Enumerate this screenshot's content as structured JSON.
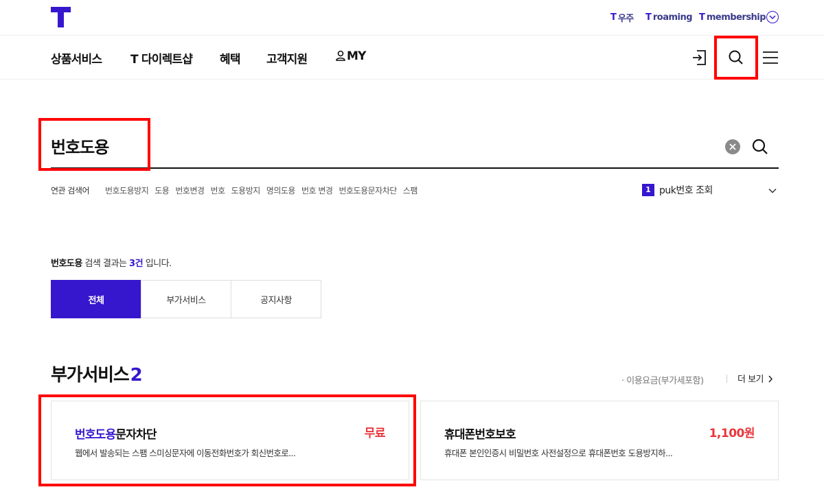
{
  "colors": {
    "brand": "#3617ce",
    "price": "#e8363b",
    "highlight": "#ff0000"
  },
  "utility_links": [
    {
      "mark": "T",
      "label": "우주"
    },
    {
      "mark": "T",
      "label": "roaming"
    },
    {
      "mark": "T",
      "label": "membership"
    }
  ],
  "gnb": {
    "items": [
      "상품서비스",
      "T 다이렉트샵",
      "혜택",
      "고객지원",
      "MY"
    ],
    "icons": [
      "login-icon",
      "search-icon",
      "menu-icon"
    ]
  },
  "search": {
    "value": "번호도용"
  },
  "related": {
    "title": "연관 검색어",
    "keywords": [
      "번호도용방지",
      "도용",
      "번호변경",
      "번호",
      "도용방지",
      "명의도용",
      "번호 변경",
      "번호도용문자차단",
      "스팸"
    ]
  },
  "ranking": {
    "rank": "1",
    "keyword": "puk번호 조회"
  },
  "summary": {
    "keyword": "번호도용",
    "middle": " 검색 결과는 ",
    "count": "3건",
    "tail": " 입니다."
  },
  "tabs": [
    {
      "label": "전체",
      "active": true
    },
    {
      "label": "부가서비스",
      "active": false
    },
    {
      "label": "공지사항",
      "active": false
    }
  ],
  "section": {
    "title": "부가서비스",
    "count": "2",
    "fee_note": "· 이용요금(부가세포함)",
    "more": "더 보기"
  },
  "cards": [
    {
      "name_highlight": "번호도용",
      "name_rest": "문자차단",
      "price": "무료",
      "desc": "웹에서 발송되는 스팸 스미싱문자에 이동전화번호가 회신번호로..."
    },
    {
      "name_highlight": "",
      "name_rest": "휴대폰번호보호",
      "price": "1,100원",
      "desc": "휴대폰 본인인증시 비밀번호 사전설정으로 휴대폰번호 도용방지하..."
    }
  ]
}
